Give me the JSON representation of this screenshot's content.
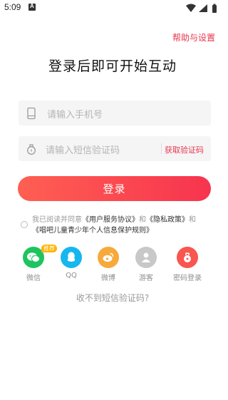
{
  "status_bar": {
    "time": "5:09",
    "notification_letter": "A"
  },
  "header": {
    "help_label": "帮助与设置"
  },
  "title": "登录后即可开始互动",
  "form": {
    "phone_placeholder": "请输入手机号",
    "code_placeholder": "请输入短信验证码",
    "get_code_label": "获取验证码",
    "login_label": "登录"
  },
  "agreement": {
    "prefix": "我已阅读并同意",
    "user_agreement": "《用户服务协议》",
    "and1": "和",
    "privacy_policy": "《隐私政策》",
    "and2": "和",
    "children_policy": "《唱吧儿童青少年个人信息保护规则》"
  },
  "social": {
    "recommend_badge": "推荐",
    "items": [
      {
        "label": "微信",
        "icon": "wechat-icon",
        "color": "#1ec460"
      },
      {
        "label": "QQ",
        "icon": "qq-icon",
        "color": "#16b6ee"
      },
      {
        "label": "微博",
        "icon": "weibo-icon",
        "color": "#f7a93b"
      },
      {
        "label": "游客",
        "icon": "guest-icon",
        "color": "#c8c8c8"
      },
      {
        "label": "密码登录",
        "icon": "password-login-icon",
        "color": "#f8564f"
      }
    ]
  },
  "no_code_label": "收不到短信验证码?",
  "colors": {
    "accent": "#e8364f",
    "button_start": "#ff5f52",
    "button_end": "#f7344f"
  }
}
